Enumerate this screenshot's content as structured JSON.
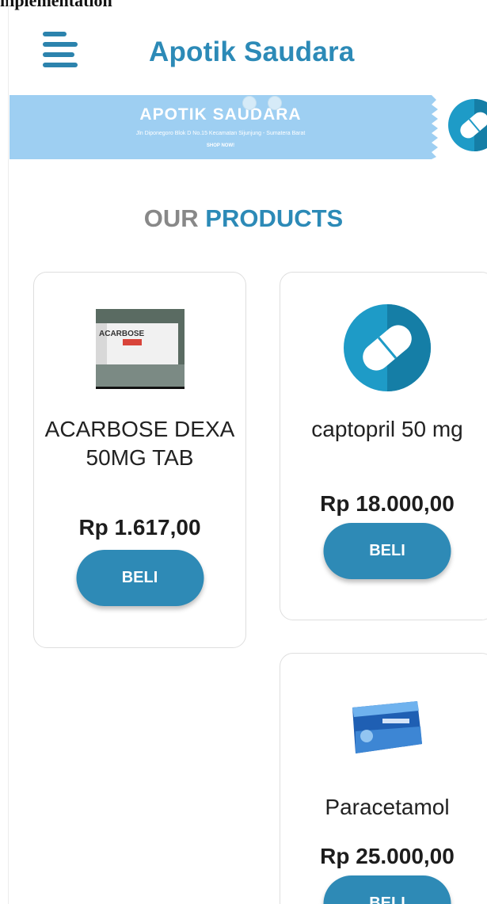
{
  "page": {
    "top_cut_text": "mplementation"
  },
  "header": {
    "menu_icon": "hamburger-menu-icon",
    "brand": "Apotik Saudara"
  },
  "banner": {
    "title": "APOTIK SAUDARA",
    "address": "Jln Diponegoro Blok D No.15 Kecamatan Sijunjung - Sumatera Barat",
    "cta": "SHOP NOW!",
    "background": "#9ecff2",
    "next_slide_icon": "capsule-icon",
    "dots": 2
  },
  "section": {
    "title_part1": "OUR",
    "title_part2": "PRODUCTS"
  },
  "products": [
    {
      "name": "ACARBOSE DEXA 50MG TAB",
      "price": "Rp 1.617,00",
      "button": "BELI",
      "image_icon": "acarbose-box-photo"
    },
    {
      "name": "captopril 50 mg",
      "price": "Rp 18.000,00",
      "button": "BELI",
      "image_icon": "capsule-icon"
    },
    {
      "name": "Paracetamol",
      "price": "Rp 25.000,00",
      "button": "BELI",
      "image_icon": "paracetamol-box-icon"
    }
  ],
  "colors": {
    "brand": "#2c8ab7",
    "button": "#2e8ab6",
    "muted_title": "#888888"
  }
}
